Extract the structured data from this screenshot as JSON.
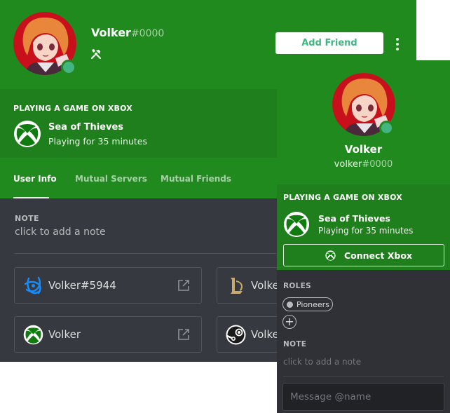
{
  "colors": {
    "header_green": "#218a1f",
    "activity_green": "#1f7f1d",
    "online": "#43b581",
    "body_dark": "#36393f",
    "popout_dark": "#2f3136"
  },
  "profile": {
    "username": "Volker",
    "discriminator": "#0000",
    "badge_icon": "hammer-wrench-icon",
    "status": "online",
    "add_friend_label": "Add Friend",
    "more_icon": "kebab-menu-icon"
  },
  "activity": {
    "title": "PLAYING A GAME ON XBOX",
    "game": "Sea of Thieves",
    "elapsed": "Playing for 35 minutes",
    "icon": "xbox-icon"
  },
  "tabs": [
    {
      "label": "User Info",
      "active": true
    },
    {
      "label": "Mutual Servers",
      "active": false
    },
    {
      "label": "Mutual Friends",
      "active": false
    }
  ],
  "note": {
    "label": "NOTE",
    "placeholder": "click to add a note"
  },
  "connections": [
    {
      "service": "battlenet",
      "icon": "battlenet-icon",
      "name": "Volker#5944"
    },
    {
      "service": "league-of-legends",
      "icon": "league-of-legends-icon",
      "name": "Volker"
    },
    {
      "service": "xbox",
      "icon": "xbox-icon",
      "name": "Volker"
    },
    {
      "service": "steam",
      "icon": "steam-icon",
      "name": "Volker"
    }
  ],
  "popout": {
    "name": "Volker",
    "tag_name": "volker",
    "tag_disc": "#0000",
    "activity_title": "PLAYING A GAME ON XBOX",
    "game": "Sea of Thieves",
    "elapsed": "Playing for 35 minutes",
    "connect_label": "Connect Xbox",
    "roles_label": "ROLES",
    "roles": [
      {
        "name": "Pioneers"
      }
    ],
    "add_role": "+",
    "note_label": "NOTE",
    "note_placeholder": "click to add a note",
    "message_placeholder": "Message @name"
  }
}
